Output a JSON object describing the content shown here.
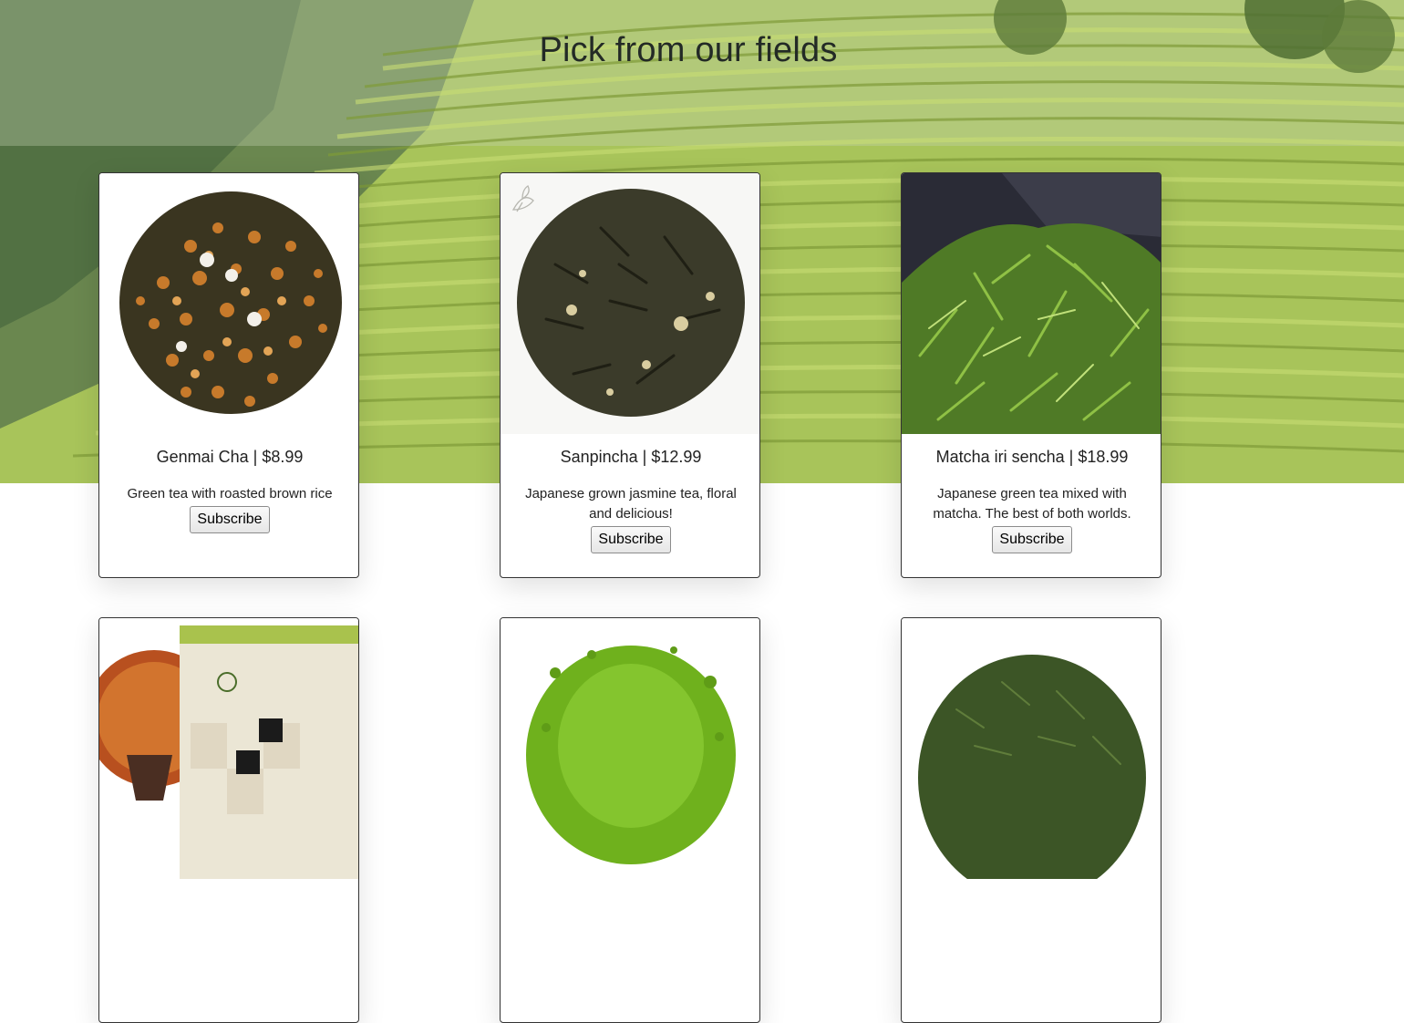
{
  "page": {
    "title": "Pick from our fields",
    "colors": {
      "accent_green": "#a9c65a",
      "card_border": "#333333"
    }
  },
  "products": [
    {
      "name_line": "Genmai Cha | $8.99",
      "description": "Green tea with roasted brown rice",
      "button": "Subscribe",
      "image": "genmaicha-leaves-image"
    },
    {
      "name_line": "Sanpincha | $12.99",
      "description": "Japanese grown jasmine tea, floral and delicious!",
      "button": "Subscribe",
      "image": "jasmine-tea-leaves-image"
    },
    {
      "name_line": "Matcha iri sencha | $18.99",
      "description": "Japanese green tea mixed with matcha. The best of both worlds.",
      "button": "Subscribe",
      "image": "sencha-leaves-image"
    },
    {
      "name_line": "",
      "description": "",
      "button": "",
      "image": "hojicha-package-image"
    },
    {
      "name_line": "",
      "description": "",
      "button": "",
      "image": "matcha-powder-image"
    },
    {
      "name_line": "",
      "description": "",
      "button": "",
      "image": "green-tea-leaves-image"
    }
  ]
}
